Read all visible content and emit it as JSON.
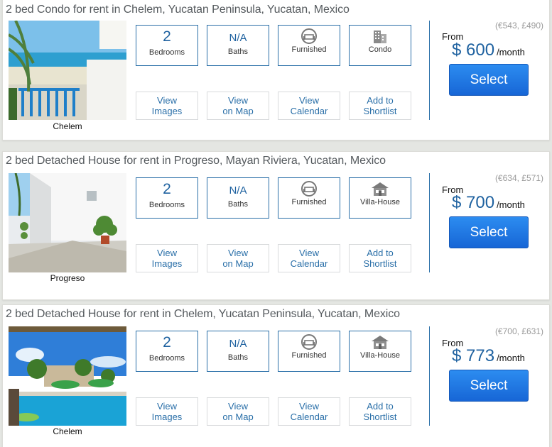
{
  "listings": [
    {
      "title": "2 bed Condo for rent in Chelem, Yucatan Peninsula, Yucatan, Mexico",
      "caption": "Chelem",
      "bedrooms_value": "2",
      "bedrooms_label": "Bedrooms",
      "baths_value": "N/A",
      "baths_label": "Baths",
      "furnished_label": "Furnished",
      "type_label": "Condo",
      "type_icon": "building-icon",
      "actions": {
        "images": "View\nImages",
        "map": "View\non Map",
        "calendar": "View\nCalendar",
        "shortlist": "Add to\nShortlist"
      },
      "conversion": "(€543, £490)",
      "from_label": "From",
      "price": "$ 600",
      "per": "/month",
      "select_label": "Select"
    },
    {
      "title": "2 bed Detached House for rent in Progreso, Mayan Riviera, Yucatan, Mexico",
      "caption": "Progreso",
      "bedrooms_value": "2",
      "bedrooms_label": "Bedrooms",
      "baths_value": "N/A",
      "baths_label": "Baths",
      "furnished_label": "Furnished",
      "type_label": "Villa-House",
      "type_icon": "house-icon",
      "actions": {
        "images": "View\nImages",
        "map": "View\non Map",
        "calendar": "View\nCalendar",
        "shortlist": "Add to\nShortlist"
      },
      "conversion": "(€634, £571)",
      "from_label": "From",
      "price": "$ 700",
      "per": "/month",
      "select_label": "Select"
    },
    {
      "title": "2 bed Detached House for rent in Chelem, Yucatan Peninsula, Yucatan, Mexico",
      "caption": "Chelem",
      "bedrooms_value": "2",
      "bedrooms_label": "Bedrooms",
      "baths_value": "N/A",
      "baths_label": "Baths",
      "furnished_label": "Furnished",
      "type_label": "Villa-House",
      "type_icon": "house-icon",
      "actions": {
        "images": "View\nImages",
        "map": "View\non Map",
        "calendar": "View\nCalendar",
        "shortlist": "Add to\nShortlist"
      },
      "conversion": "(€700, £631)",
      "from_label": "From",
      "price": "$ 773",
      "per": "/month",
      "select_label": "Select"
    }
  ]
}
